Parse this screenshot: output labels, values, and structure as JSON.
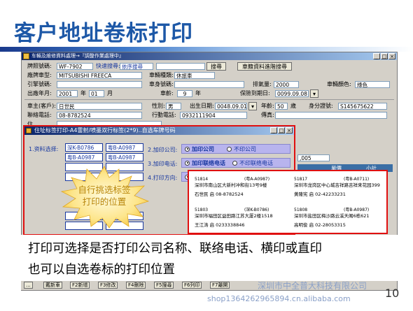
{
  "slide": {
    "title": "客户地址卷标打印",
    "caption_line1": "打印可选择是否打印公司名称、联络电话、横印或直印",
    "caption_line2": "也可以自选卷标的打印位置",
    "watermark_line1": "深圳市中全普大科技有限公司",
    "watermark_line2": "shop1364262965894.cn.alibaba.com",
    "page_number": "10"
  },
  "main_window": {
    "title": "车輛及維修資料處理→『調整作業處理中』",
    "fields": {
      "plate_label": "牌照號碼:",
      "plate_value": "WF-7902",
      "quick_search_label": "快速搜尋:",
      "quick_search_value": "依序搜尋",
      "search_button": "搜尋",
      "trace_button": "車籍資料進階搜尋",
      "model_label": "廠牌車型:",
      "model_value": "MITSUBISHI FREECA",
      "type_label": "車輛種類:",
      "type_value": "休旅車",
      "engine_label": "引擎號碼:",
      "body_label": "車身號碼:",
      "cc_label": "排氣量:",
      "cc_value": "2000",
      "color_label": "車輛顏色:",
      "color_value": "綠色",
      "year_label": "出廠年月:",
      "year_value": "2001",
      "year_unit": "年",
      "month_value": "01",
      "month_unit": "月",
      "age_label": "車齡:",
      "age_value": "9",
      "age_unit": "年",
      "insurance_label": "保險到期日:",
      "insurance_value": "0099.09.08",
      "owner_label": "車主(客戶):",
      "owner_value": "日世民",
      "sex_label": "性別:",
      "sex_value": "男",
      "birth_label": "出生日期:",
      "birth_value": "0048.09.01",
      "age2_label": "年齡:",
      "age2_value": "50",
      "age2_unit": "歲",
      "id_label": "身分證號:",
      "id_value": "S145675622",
      "tel_label": "聯絡電話:",
      "tel_value": "08-8782524",
      "mobile_label": "行動電話:",
      "mobile_value": "0932111904",
      "fax_label": "傳真:",
      "addr_label": "住",
      "number_value": ",005",
      "col_unit": "單價",
      "col_subtotal": "小計"
    }
  },
  "dialog": {
    "title": "住址标签打印-A4雷射/喷墨双行标签(2*9)..自选车牌号码",
    "step1_label": "1.资料选择:",
    "plates": [
      "深K-B0786",
      "粤B-A0987",
      "粤B-A0987",
      "粤B-A0987",
      "",
      "",
      "",
      "",
      "",
      "",
      "",
      ""
    ],
    "step2_label": "2.加印公司:",
    "step2_opt1": "加印公司",
    "step2_opt2": "不印公司",
    "step3_label": "3.加印电话:",
    "step3_opt1": "加印联络电话",
    "step3_opt2": "不印联络电话",
    "step4_label": "4.打印方向:",
    "burst_text_line1": "自行挑选标签",
    "burst_text_line2": "打印的位置"
  },
  "label_preview": [
    {
      "zip": "51814",
      "ref": "(粤A-A0987)",
      "addr": "深圳市南山区大新村冲和街13号9楼",
      "name": "石世民 启 08-8782524"
    },
    {
      "zip": "51817",
      "ref": "(粤B-A0711)",
      "addr": "深圳市龙岗区中心城吉祥路吉祥来花园399",
      "name": "黄隆宪 启 02-42233231"
    },
    {
      "zip": "51803",
      "ref": "(深K-B0786)",
      "addr": "深圳市福田区益田路江苏大厦2楼1518",
      "name": "王江涛 启 0233338846"
    },
    {
      "zip": "51808",
      "ref": "(粤B-A0987)",
      "addr": "深圳市盐田区梅沙路云溪天阁6栋621",
      "name": "高明俊 启 02-28053315"
    }
  ],
  "status_bar": {
    "keys": [
      "...",
      "戴新車",
      "F2新增",
      "F3修改",
      "F4刪除",
      "F5搜尋",
      "F6列印",
      "F7離開"
    ]
  },
  "colors": {
    "title_blue": "#1d58a7",
    "highlight_red": "#e01010",
    "dialog_blue": "#1838a0",
    "option_purple": "#b8b4ee"
  }
}
